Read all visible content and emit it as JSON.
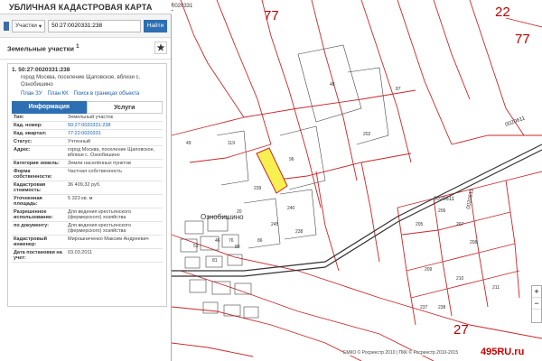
{
  "app_title": "УБЛИЧНАЯ КАДАСТРОВАЯ КАРТА",
  "search": {
    "type_label": "Участки",
    "value": "50:27:0020331:238",
    "button_label": "Найти"
  },
  "section_title": "Земельные участки",
  "section_count": "1",
  "result": {
    "index": "1.",
    "cad_number": "50:27:0020331:238",
    "address_short": "город Москва, поселение Щаповское, вблизи с. Ознобишино",
    "links": [
      "План ЗУ",
      "План КК",
      "Поиск в границах объекта"
    ]
  },
  "tabs": {
    "info": "Информация",
    "services": "Услуги"
  },
  "info_rows": [
    {
      "k": "Тип:",
      "v": "Земельный участок",
      "link": false
    },
    {
      "k": "Кад. номер:",
      "v": "50:27:0020331:238",
      "link": true
    },
    {
      "k": "Кад. квартал:",
      "v": "77:22:0020331",
      "link": true
    },
    {
      "k": "Статус:",
      "v": "Учтенный",
      "link": false
    },
    {
      "k": "Адрес:",
      "v": "город Москва, поселение Щаповское, вблизи с. Ознобишино",
      "link": false
    },
    {
      "k": "Категория земель:",
      "v": "Земли населённых пунктов",
      "link": false
    },
    {
      "k": "Форма собственности:",
      "v": "Частная собственность",
      "link": false
    },
    {
      "k": "Кадастровая стоимость:",
      "v": "36 409,32 руб.",
      "link": false
    },
    {
      "k": "Уточненная площадь:",
      "v": "5 323 кв. м",
      "link": false
    },
    {
      "k": "Разрешенное использование:",
      "v": "Для ведения крестьянского (фермерского) хозяйства",
      "link": false
    },
    {
      "k": "по документу:",
      "v": "Для ведения крестьянского (фермерского) хозяйства",
      "link": false
    },
    {
      "k": "Кадастровый инженер:",
      "v": "Мирошниченко Максим Андреевич",
      "link": false
    },
    {
      "k": "Дата постановки на учет:",
      "v": "03.03.2011",
      "link": false
    }
  ],
  "map_labels": {
    "block_77a": "77",
    "block_77b": "77",
    "block_22a": "22",
    "block_22b": "22",
    "block_27": "27",
    "code_top": "0020331",
    "code_right1": "0020611",
    "code_right2": "0020611",
    "code_right3": "0020611",
    "village": "Ознобишино",
    "parcels": [
      "119",
      "49",
      "48",
      "87",
      "96",
      "239",
      "240",
      "238",
      "86",
      "245",
      "202",
      "53",
      "20",
      "76",
      "46",
      "206",
      "207",
      "208",
      "209",
      "210",
      "237",
      "238",
      "205",
      "80",
      "81",
      "211"
    ]
  },
  "footer_text": "ЕМКО © Росреестр 2010 | ПКК © Росреестр 2010-2015",
  "brand": "495RU.ru"
}
